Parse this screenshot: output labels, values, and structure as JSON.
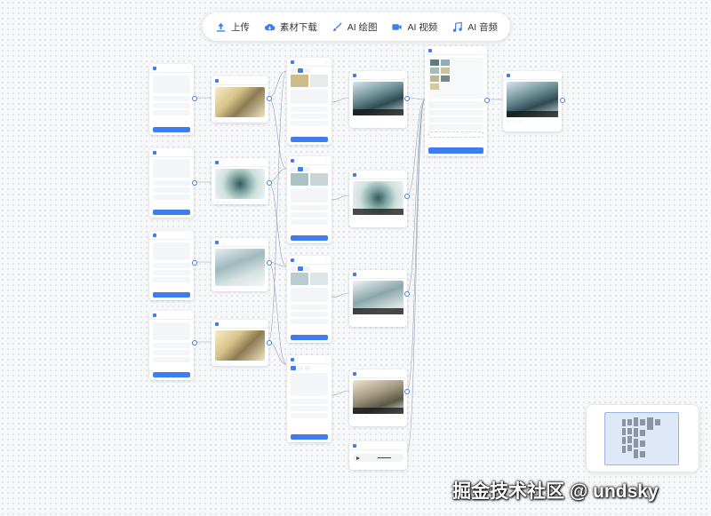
{
  "toolbar": {
    "upload": "上传",
    "library": "素材下载",
    "drawing": "AI 绘图",
    "video": "AI 视频",
    "audio": "AI 音频"
  },
  "watermark": "掘金技术社区 @ undsky",
  "colors": {
    "accent": "#3d7df0",
    "link": "#9aa3b5"
  }
}
